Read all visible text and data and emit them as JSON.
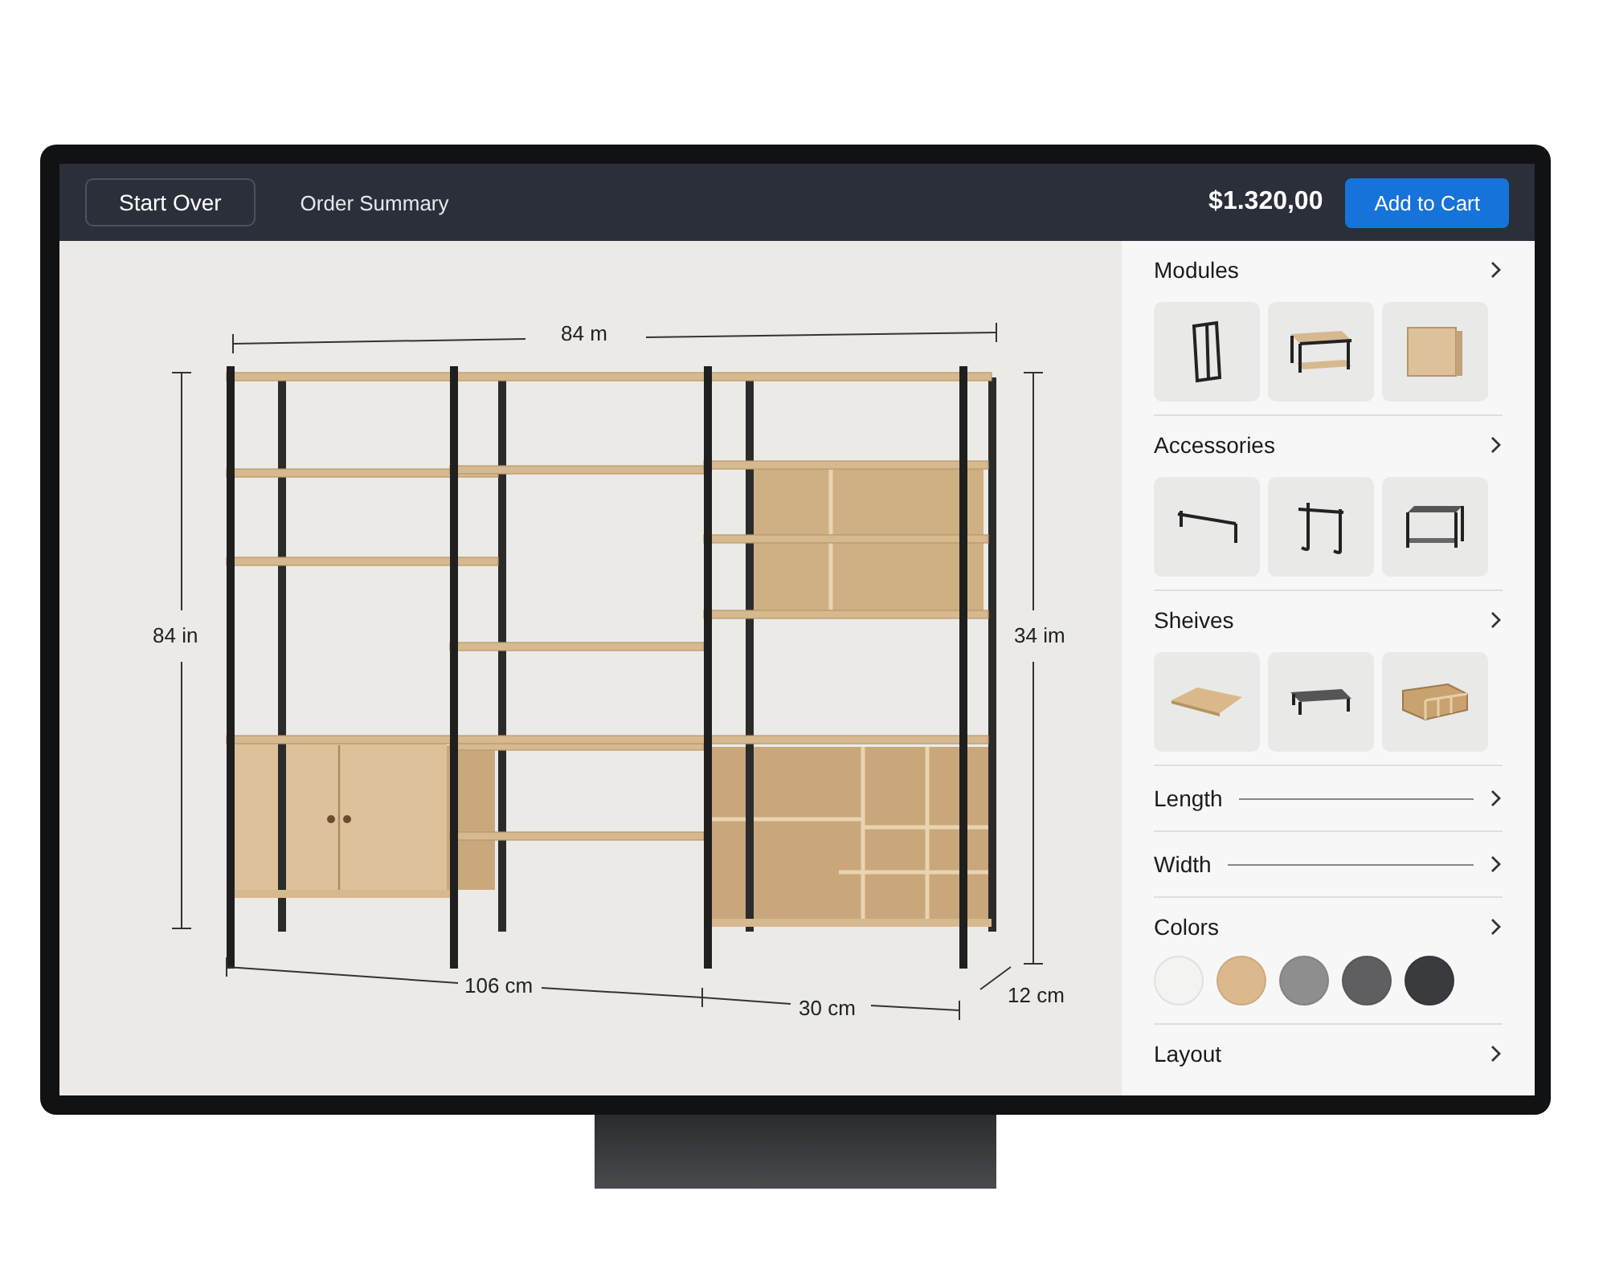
{
  "top_bar": {
    "start_over": "Start Over",
    "order_summary": "Order Summary",
    "price": "$1.320,00",
    "add_to_cart": "Add to Cart"
  },
  "dimensions": {
    "top": "84 m",
    "left": "84 in",
    "right": "34 im",
    "bottom_left": "106 cm",
    "bottom_right": "30 cm",
    "depth": "12 cm"
  },
  "panel_sections": [
    {
      "kind": "thumbnails",
      "title": "Modules"
    },
    {
      "kind": "thumbnails",
      "title": "Accessories"
    },
    {
      "kind": "thumbnails",
      "title": "Sheives"
    },
    {
      "kind": "slider",
      "title": "Length"
    },
    {
      "kind": "slider",
      "title": "Width"
    },
    {
      "kind": "swatches",
      "title": "Colors",
      "swatches": [
        {
          "color": "#f3f3f2"
        },
        {
          "color": "#dcb98c"
        },
        {
          "color": "#8e8e8e"
        },
        {
          "color": "#5f5f61"
        },
        {
          "color": "#3a3b3e"
        }
      ]
    },
    {
      "kind": "plain",
      "title": "Layout"
    }
  ]
}
